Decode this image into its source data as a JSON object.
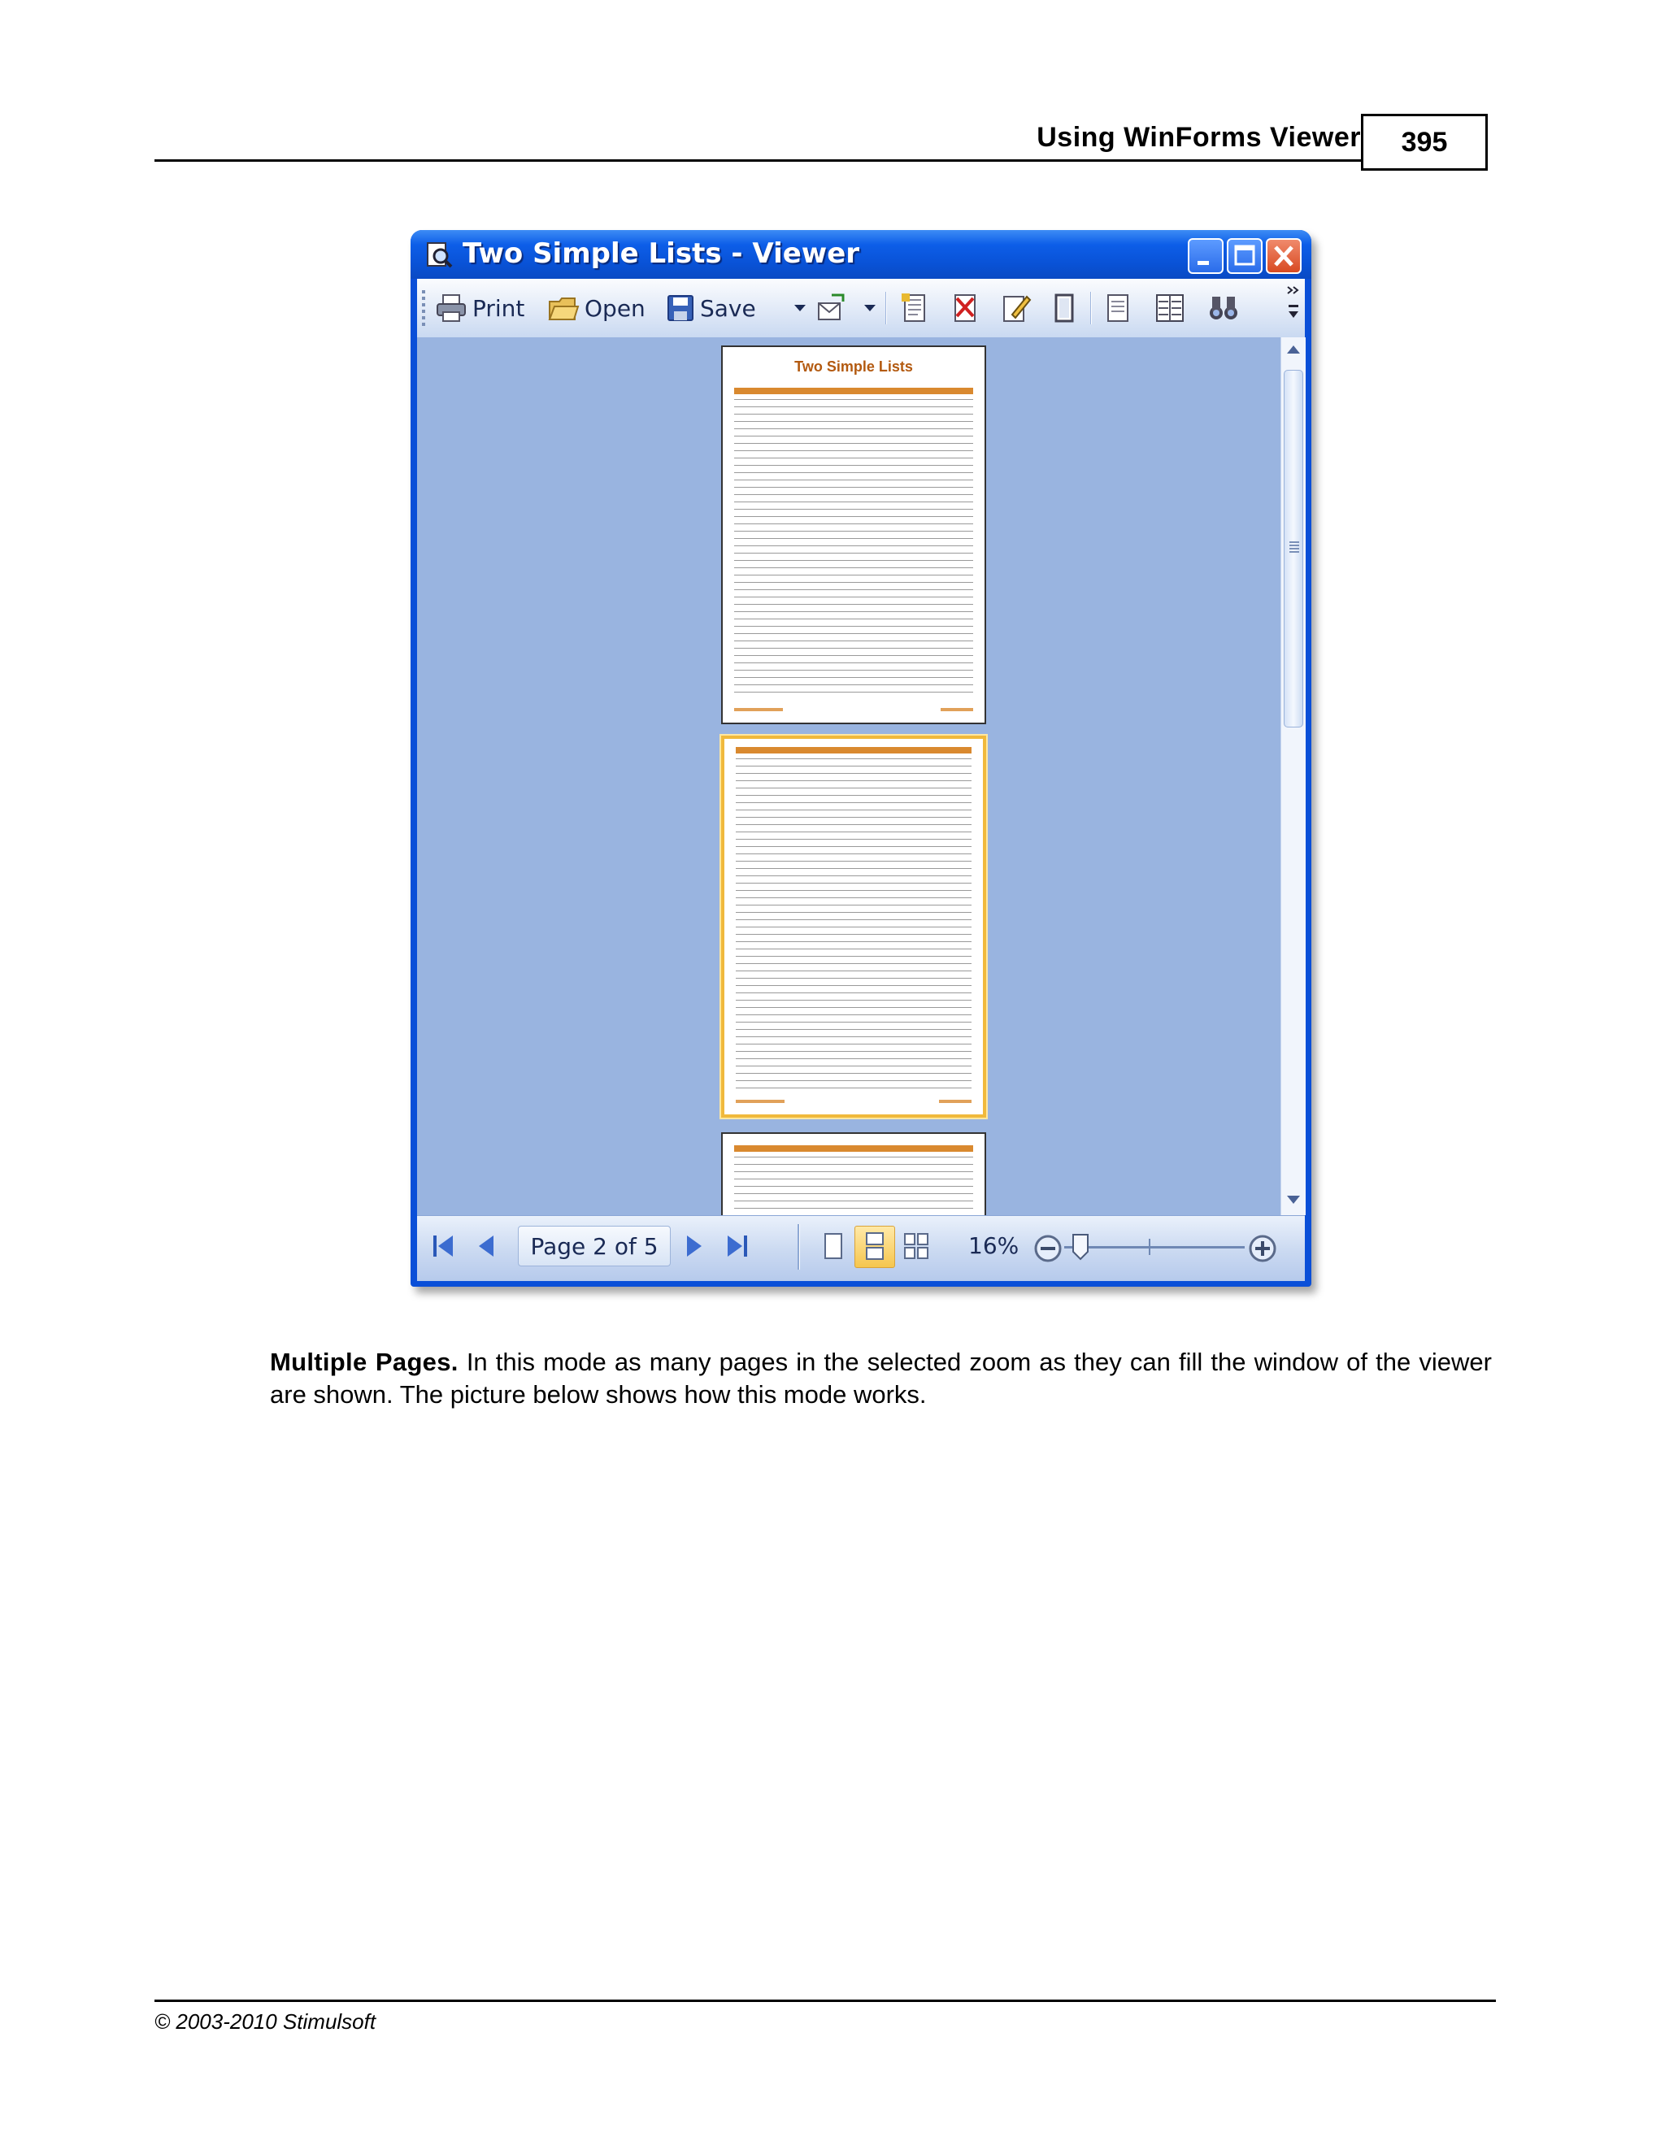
{
  "header": {
    "section_title": "Using WinForms Viewer",
    "page_number": "395"
  },
  "window": {
    "title": "Two Simple Lists - Viewer",
    "toolbar": {
      "print_label": "Print",
      "open_label": "Open",
      "save_label": "Save"
    },
    "pages": [
      {
        "title": "Two Simple Lists",
        "selected": false
      },
      {
        "title": "",
        "selected": true
      },
      {
        "title": "",
        "selected": false
      }
    ],
    "status": {
      "page_indicator": "Page 2 of 5",
      "zoom": "16%"
    }
  },
  "body": {
    "lead": "Multiple Pages.",
    "text": " In this mode as many pages in the selected zoom as they can fill the window of the viewer are shown. The picture below shows how this mode works."
  },
  "footer": {
    "copyright": "© 2003-2010 Stimulsoft"
  }
}
